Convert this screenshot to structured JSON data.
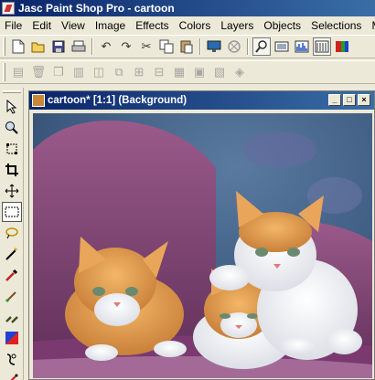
{
  "app": {
    "title": "Jasc Paint Shop Pro - cartoon"
  },
  "menu": [
    "File",
    "Edit",
    "View",
    "Image",
    "Effects",
    "Colors",
    "Layers",
    "Objects",
    "Selections",
    "Masks"
  ],
  "toolbar1": [
    "new-icon",
    "open-icon",
    "save-icon",
    "print-icon",
    "undo-icon",
    "redo-icon",
    "cut-icon",
    "copy-icon",
    "paste-icon",
    "screen-icon",
    "browse-icon",
    "zoom-icon",
    "overview-icon",
    "histogram-icon",
    "color-palette-icon",
    "layers-icon"
  ],
  "toolbar2": [
    "layer-new-icon",
    "layer-delete-icon",
    "layer-duplicate-icon",
    "layer-props-icon",
    "layer-mask-icon",
    "layer-group-icon",
    "layer-merge-icon",
    "layer-up-icon",
    "layer-down-icon",
    "layer-view-icon",
    "layer-link-icon",
    "layer-lock-icon"
  ],
  "tools": [
    "arrow-tool-icon",
    "zoom-tool-icon",
    "deform-tool-icon",
    "crop-tool-icon",
    "mover-tool-icon",
    "selection-tool-icon",
    "freehand-tool-icon",
    "magic-wand-icon",
    "dropper-tool-icon",
    "paintbrush-tool-icon",
    "clone-brush-icon",
    "color-replacer-icon",
    "retouch-tool-icon",
    "scratch-remover-icon"
  ],
  "document": {
    "title": "cartoon* [1:1] (Background)",
    "buttons": {
      "minimize": "_",
      "maximize": "□",
      "close": "×"
    }
  }
}
